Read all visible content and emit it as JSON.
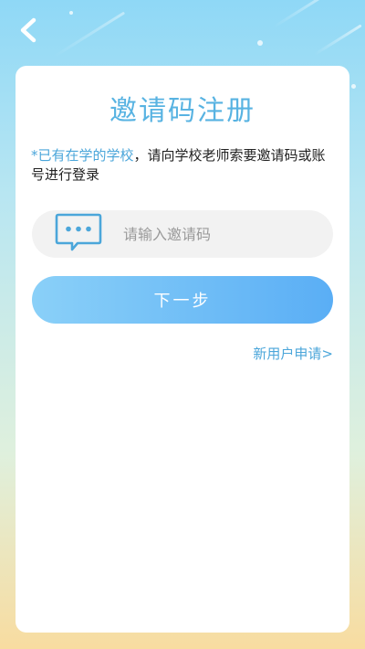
{
  "nav": {
    "back_icon": "chevron-left-icon"
  },
  "register": {
    "title": "邀请码注册",
    "notice_highlight": "*已有在学的学校",
    "notice_text": "，请向学校老师索要邀请码或账号进行登录",
    "code_input": {
      "icon": "chat-bubble-icon",
      "value": "",
      "placeholder": "请输入邀请码"
    },
    "next_label": "下一步",
    "new_user_link": "新用户申请>"
  },
  "colors": {
    "accent": "#58b3e2",
    "link": "#4ba6da",
    "button_start": "#8ad0f8",
    "button_end": "#5aaef5",
    "input_bg": "#f2f2f2"
  }
}
